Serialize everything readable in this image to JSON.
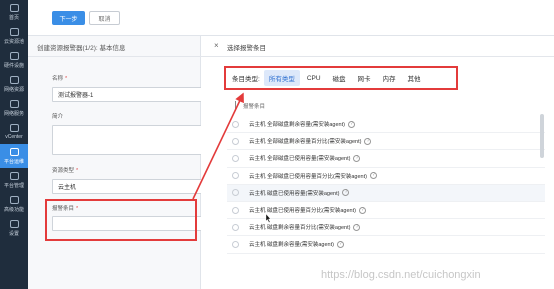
{
  "nav": {
    "items": [
      {
        "label": "首页"
      },
      {
        "label": "云资源池"
      },
      {
        "label": "硬件设施"
      },
      {
        "label": "网络资源"
      },
      {
        "label": "网络服务"
      },
      {
        "label": "vCenter"
      },
      {
        "label": "平台运维"
      },
      {
        "label": "平台管理"
      },
      {
        "label": "高级功能"
      },
      {
        "label": "设置"
      }
    ],
    "active_index": 6
  },
  "toolbar": {
    "next_label": "下一步",
    "cancel_label": "取消"
  },
  "left_panel": {
    "title": "创建资源报警器(1/2): 基本信息",
    "name_label": "名称",
    "name_value": "测试报警器-1",
    "desc_label": "简介",
    "resource_type_label": "资源类型",
    "resource_type_value": "云主机",
    "alarm_item_label": "报警条目"
  },
  "right_panel": {
    "close_icon": "close-icon",
    "title": "选择报警条目",
    "category_label": "条目类型:",
    "categories": [
      "所有类型",
      "CPU",
      "磁盘",
      "网卡",
      "内存",
      "其他"
    ],
    "active_category": 0,
    "list_header": "报警条目",
    "items": [
      "云主机 全部磁盘剩余容量(需安装agent)",
      "云主机 全部磁盘剩余容量百分比(需安装agent)",
      "云主机 全部磁盘已使用容量(需安装agent)",
      "云主机 全部磁盘已使用容量百分比(需安装agent)",
      "云主机 磁盘已使用容量(需安装agent)",
      "云主机 磁盘已使用容量百分比(需安装agent)",
      "云主机 磁盘剩余容量百分比(需安装agent)",
      "云主机 磁盘剩余容量(需安装agent)"
    ],
    "highlighted_index": 4
  },
  "watermark": "https://blog.csdn.net/cuichongxin",
  "colors": {
    "accent": "#3a8ee6",
    "annotation_red": "#e33b3b",
    "nav_bg": "#1f2d3d"
  }
}
